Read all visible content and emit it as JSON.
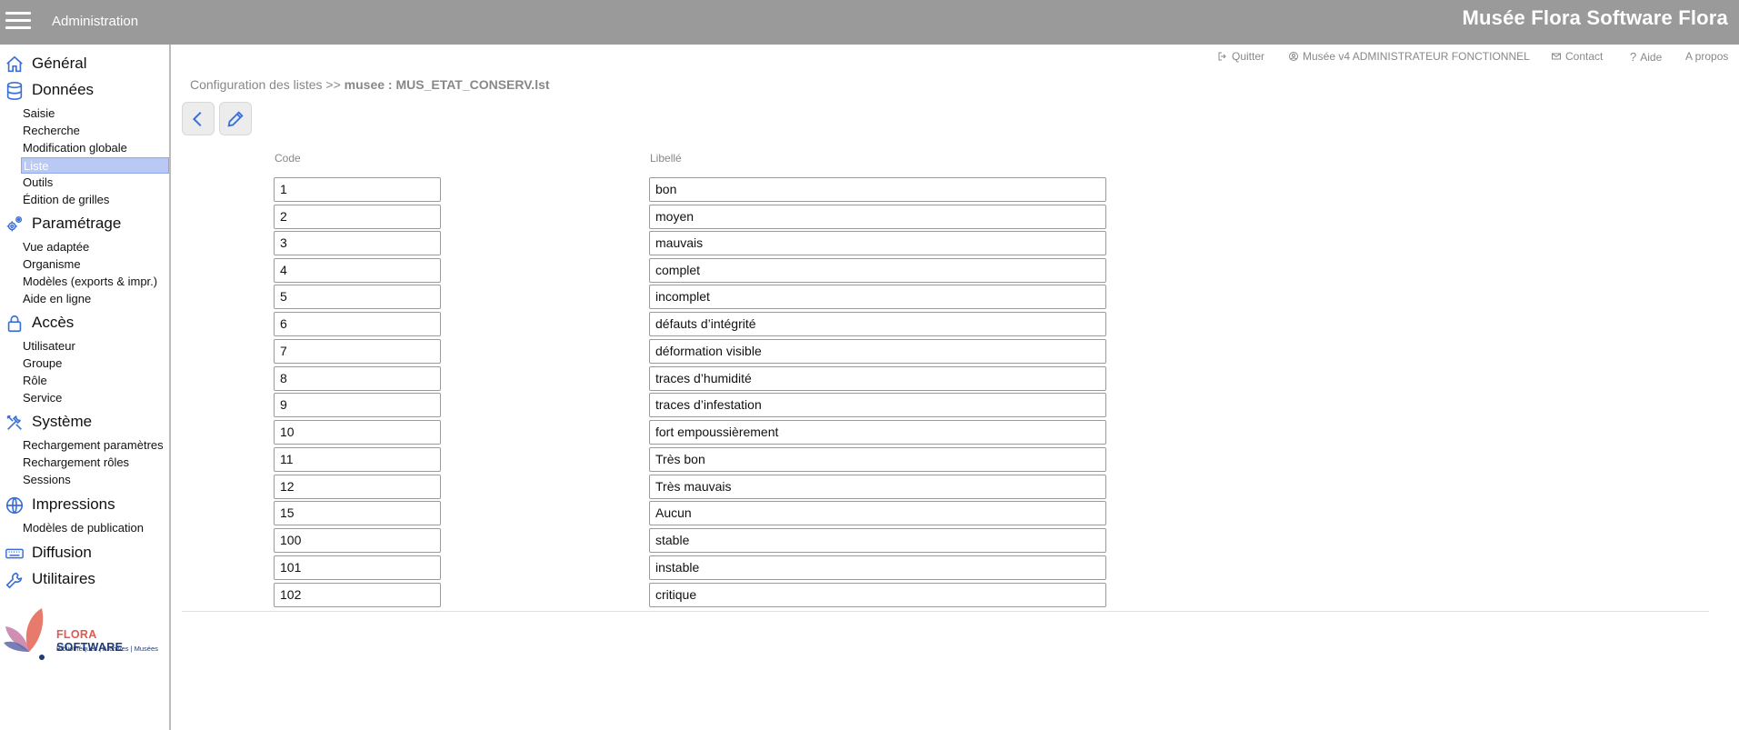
{
  "header": {
    "app_title": "Administration",
    "brand": "Musée Flora Software Flora"
  },
  "sidebar": {
    "sections": [
      {
        "label": "Général",
        "icon": "home-icon",
        "items": []
      },
      {
        "label": "Données",
        "icon": "database-icon",
        "items": [
          "Saisie",
          "Recherche",
          "Modification globale",
          "Liste",
          "Outils",
          "Édition de grilles"
        ]
      },
      {
        "label": "Paramétrage",
        "icon": "gears-icon",
        "items": [
          "Vue adaptée",
          "Organisme",
          "Modèles (exports & impr.)",
          "Aide en ligne"
        ]
      },
      {
        "label": "Accès",
        "icon": "lock-icon",
        "items": [
          "Utilisateur",
          "Groupe",
          "Rôle",
          "Service"
        ]
      },
      {
        "label": "Système",
        "icon": "tools-icon",
        "items": [
          "Rechargement paramètres",
          "Rechargement rôles",
          "Sessions"
        ]
      },
      {
        "label": "Impressions",
        "icon": "globe-icon",
        "items": [
          "Modèles de publication"
        ]
      },
      {
        "label": "Diffusion",
        "icon": "keyboard-icon",
        "items": []
      },
      {
        "label": "Utilitaires",
        "icon": "wrench-icon",
        "items": []
      }
    ],
    "active_item": "Liste",
    "logo": {
      "name": "FLORA",
      "name2": "SOFTWARE",
      "tagline": "Bibliothèques | Archives | Musées"
    }
  },
  "toplinks": {
    "quit": "Quitter",
    "user": "Musée v4 ADMINISTRATEUR FONCTIONNEL",
    "contact": "Contact",
    "help": "Aide",
    "about": "A propos"
  },
  "breadcrumb": {
    "prefix": "Configuration des listes >> ",
    "current": "musee : MUS_ETAT_CONSERV.lst"
  },
  "table": {
    "code_header": "Code",
    "label_header": "Libellé",
    "rows": [
      {
        "code": "1",
        "label": "bon"
      },
      {
        "code": "2",
        "label": "moyen"
      },
      {
        "code": "3",
        "label": "mauvais"
      },
      {
        "code": "4",
        "label": "complet"
      },
      {
        "code": "5",
        "label": "incomplet"
      },
      {
        "code": "6",
        "label": "défauts d’intégrité"
      },
      {
        "code": "7",
        "label": "déformation visible"
      },
      {
        "code": "8",
        "label": "traces d’humidité"
      },
      {
        "code": "9",
        "label": "traces d’infestation"
      },
      {
        "code": "10",
        "label": "fort empoussièrement"
      },
      {
        "code": "11",
        "label": "Très bon"
      },
      {
        "code": "12",
        "label": "Très mauvais"
      },
      {
        "code": "15",
        "label": "Aucun"
      },
      {
        "code": "100",
        "label": "stable"
      },
      {
        "code": "101",
        "label": "instable"
      },
      {
        "code": "102",
        "label": "critique"
      }
    ]
  },
  "colors": {
    "accent": "#3b6fd8",
    "header_bg": "#9a9a9a",
    "active_bg": "#b9c8f4"
  }
}
